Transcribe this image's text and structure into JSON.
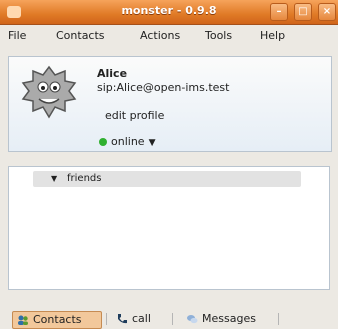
{
  "window": {
    "title": "monster - 0.9.8"
  },
  "menu": [
    "File",
    "Contacts",
    "Actions",
    "Tools",
    "Help"
  ],
  "profile": {
    "name": "Alice",
    "sip": "sip:Alice@open-ims.test",
    "edit_label": "edit profile",
    "status": "online",
    "status_color": "#30b030"
  },
  "groups": [
    {
      "label": "friends"
    }
  ],
  "tabs": [
    {
      "label": "Contacts",
      "active": true,
      "icon": "contacts-icon"
    },
    {
      "label": "call",
      "active": false,
      "icon": "phone-icon"
    },
    {
      "label": "Messages",
      "active": false,
      "icon": "messages-icon"
    }
  ]
}
